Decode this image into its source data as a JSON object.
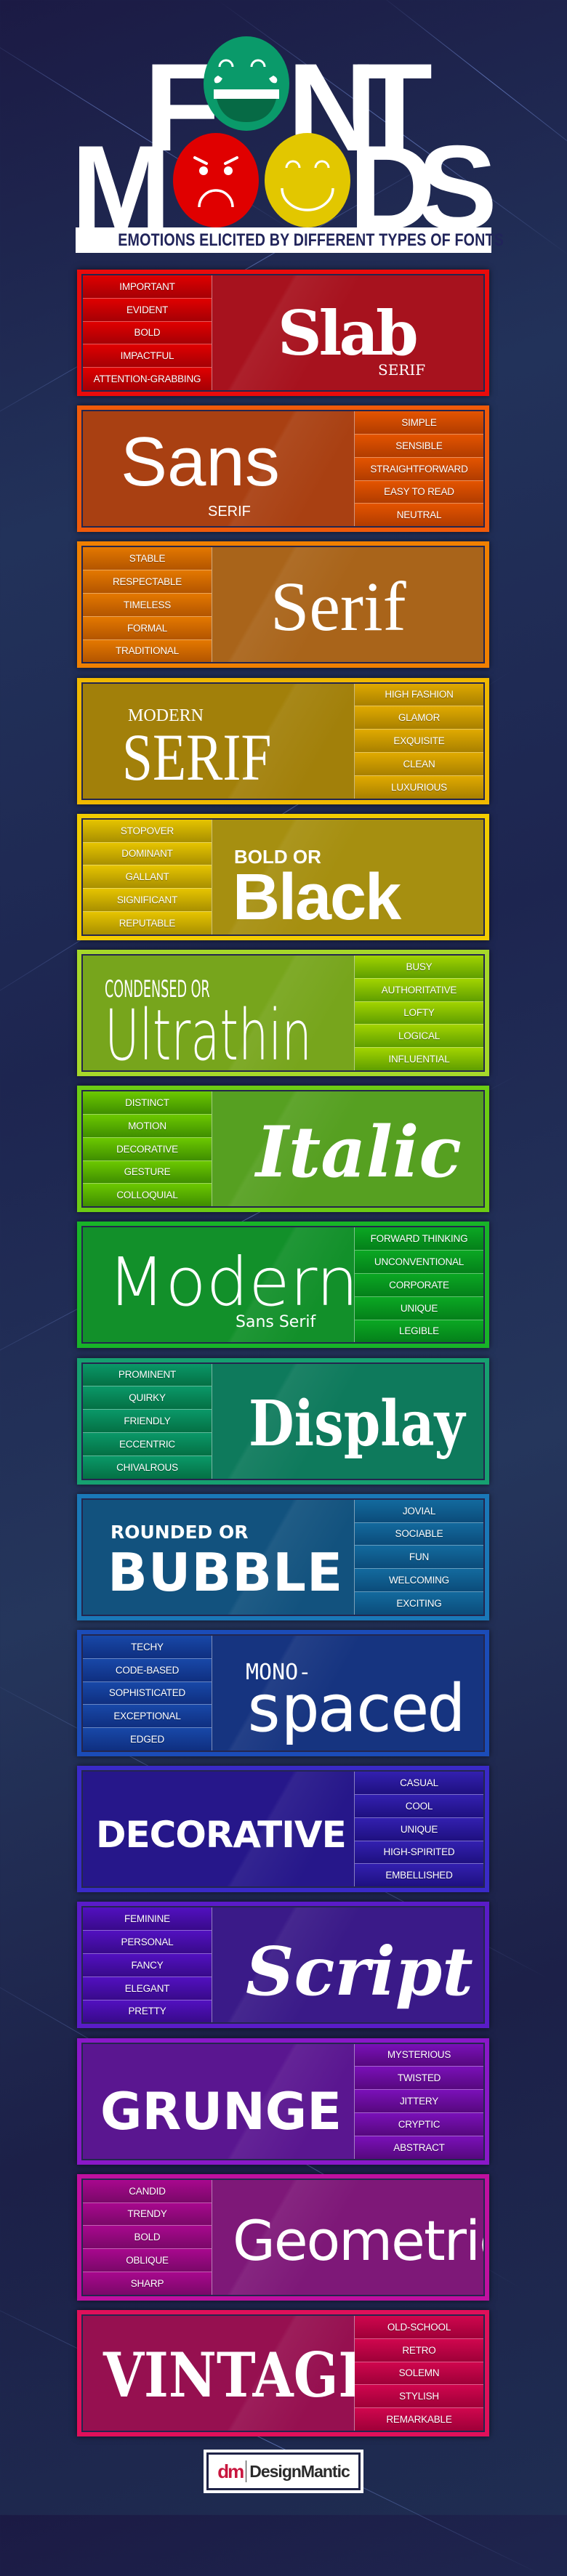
{
  "header": {
    "title_row1": {
      "left": "F",
      "right1": "N",
      "right2": "T"
    },
    "title_row2": {
      "left": "M",
      "right1": "D",
      "right2": "S"
    },
    "faces": [
      {
        "name": "laughing-face",
        "color": "#0a9a6a",
        "accent": "#066a45"
      },
      {
        "name": "angry-face",
        "color": "#e00000"
      },
      {
        "name": "happy-face",
        "color": "#e2c700"
      }
    ],
    "subtitle": "EMOTIONS ELICITED BY DIFFERENT TYPES OF FONTS"
  },
  "panels": [
    {
      "id": "slab",
      "tag_side": "left",
      "border": "#ea0b0b",
      "bg": "#a7121e",
      "tag_top": "#e00000",
      "tag_bot": "#a50005",
      "title": "Slab",
      "subtitle": "SERIF",
      "tags": [
        "IMPORTANT",
        "EVIDENT",
        "BOLD",
        "IMPACTFUL",
        "ATTENTION-GRABBING"
      ]
    },
    {
      "id": "sans",
      "tag_side": "right",
      "border": "#f05a0a",
      "bg": "#a94012",
      "tag_top": "#e45400",
      "tag_bot": "#b13c00",
      "title": "Sans",
      "subtitle": "SERIF",
      "tags": [
        "SIMPLE",
        "SENSIBLE",
        "STRAIGHTFORWARD",
        "EASY TO READ",
        "NEUTRAL"
      ]
    },
    {
      "id": "serif",
      "tag_side": "left",
      "border": "#f08000",
      "bg": "#a9641a",
      "tag_top": "#e47800",
      "tag_bot": "#b35500",
      "title": "Serif",
      "subtitle": "",
      "tags": [
        "STABLE",
        "RESPECTABLE",
        "TIMELESS",
        "FORMAL",
        "TRADITIONAL"
      ]
    },
    {
      "id": "modern-serif",
      "tag_side": "right",
      "border": "#f0b800",
      "bg": "#a2800a",
      "tag_top": "#e0aa00",
      "tag_bot": "#a88000",
      "title": "SERIF",
      "subtitle": "MODERN",
      "tags": [
        "HIGH FASHION",
        "GLAMOR",
        "EXQUISITE",
        "CLEAN",
        "LUXURIOUS"
      ]
    },
    {
      "id": "bold-black",
      "tag_side": "left",
      "border": "#f2cc00",
      "bg": "#a68f10",
      "tag_top": "#e6c400",
      "tag_bot": "#a88f00",
      "title": "Black",
      "subtitle": "BOLD OR",
      "tags": [
        "STOPOVER",
        "DOMINANT",
        "GALLANT",
        "SIGNIFICANT",
        "REPUTABLE"
      ]
    },
    {
      "id": "ultrathin",
      "tag_side": "right",
      "border": "#a6d82a",
      "bg": "#77a51c",
      "tag_top": "#a2d400",
      "tag_bot": "#5f9e00",
      "title": "Ultrathin",
      "subtitle": "CONDENSED OR",
      "tags": [
        "BUSY",
        "AUTHORITATIVE",
        "LOFTY",
        "LOGICAL",
        "INFLUENTIAL"
      ]
    },
    {
      "id": "italic",
      "tag_side": "left",
      "border": "#6ccc14",
      "bg": "#56a021",
      "tag_top": "#6cc800",
      "tag_bot": "#3f8e00",
      "title": "Italic",
      "subtitle": "",
      "tags": [
        "DISTINCT",
        "MOTION",
        "DECORATIVE",
        "GESTURE",
        "COLLOQUIAL"
      ]
    },
    {
      "id": "modern-sans",
      "tag_side": "right",
      "border": "#18b428",
      "bg": "#12902a",
      "tag_top": "#0ba823",
      "tag_bot": "#04801a",
      "title": "Modern",
      "subtitle": "Sans Serif",
      "tags": [
        "FORWARD THINKING",
        "UNCONVENTIONAL",
        "CORPORATE",
        "UNIQUE",
        "LEGIBLE"
      ]
    },
    {
      "id": "display",
      "tag_side": "left",
      "border": "#16a070",
      "bg": "#0e7a5c",
      "tag_top": "#0a9868",
      "tag_bot": "#047044",
      "title": "Display",
      "subtitle": "",
      "tags": [
        "PROMINENT",
        "QUIRKY",
        "FRIENDLY",
        "ECCENTRIC",
        "CHIVALROUS"
      ]
    },
    {
      "id": "bubble",
      "tag_side": "right",
      "border": "#1a78b8",
      "bg": "#12527e",
      "tag_top": "#136a9e",
      "tag_bot": "#0b4c7a",
      "title": "BUBBLE",
      "subtitle": "ROUNDED OR",
      "tags": [
        "JOVIAL",
        "SOCIABLE",
        "FUN",
        "WELCOMING",
        "EXCITING"
      ]
    },
    {
      "id": "monospaced",
      "tag_side": "left",
      "border": "#1b4cb8",
      "bg": "#163480",
      "tag_top": "#1848a8",
      "tag_bot": "#0f2f80",
      "title": "spaced",
      "subtitle": "MONO-",
      "tags": [
        "TECHY",
        "CODE-BASED",
        "SOPHISTICATED",
        "EXCEPTIONAL",
        "EDGED"
      ]
    },
    {
      "id": "decorative",
      "tag_side": "right",
      "border": "#3a2ac8",
      "bg": "#26178a",
      "tag_top": "#3320b0",
      "tag_bot": "#1e1080",
      "title": "DECORATIVE",
      "subtitle": "",
      "tags": [
        "CASUAL",
        "COOL",
        "UNIQUE",
        "HIGH-SPIRITED",
        "EMBELLISHED"
      ]
    },
    {
      "id": "script",
      "tag_side": "left",
      "border": "#5a1cc8",
      "bg": "#3a1a88",
      "tag_top": "#5210c0",
      "tag_bot": "#380a8a",
      "title": "Script",
      "subtitle": "",
      "tags": [
        "FEMININE",
        "PERSONAL",
        "FANCY",
        "ELEGANT",
        "PRETTY"
      ]
    },
    {
      "id": "grunge",
      "tag_side": "right",
      "border": "#8a18c8",
      "bg": "#5a1690",
      "tag_top": "#7a10b8",
      "tag_bot": "#56087e",
      "title": "GRUNGE",
      "subtitle": "",
      "tags": [
        "MYSTERIOUS",
        "TWISTED",
        "JITTERY",
        "CRYPTIC",
        "ABSTRACT"
      ]
    },
    {
      "id": "geometric",
      "tag_side": "left",
      "border": "#c010a0",
      "bg": "#7e1878",
      "tag_top": "#a8088e",
      "tag_bot": "#7a0868",
      "title": "Geometric",
      "subtitle": "",
      "tags": [
        "CANDID",
        "TRENDY",
        "BOLD",
        "OBLIQUE",
        "SHARP"
      ]
    },
    {
      "id": "vintage",
      "tag_side": "right",
      "border": "#e0105a",
      "bg": "#961050",
      "tag_top": "#d0064e",
      "tag_bot": "#9e0038",
      "title": "VINTAGE",
      "subtitle": "",
      "tags": [
        "OLD-SCHOOL",
        "RETRO",
        "SOLEMN",
        "STYLISH",
        "REMARKABLE"
      ]
    }
  ],
  "footer": {
    "logo_mark": "dm",
    "logo_name": "DesignMantic"
  }
}
